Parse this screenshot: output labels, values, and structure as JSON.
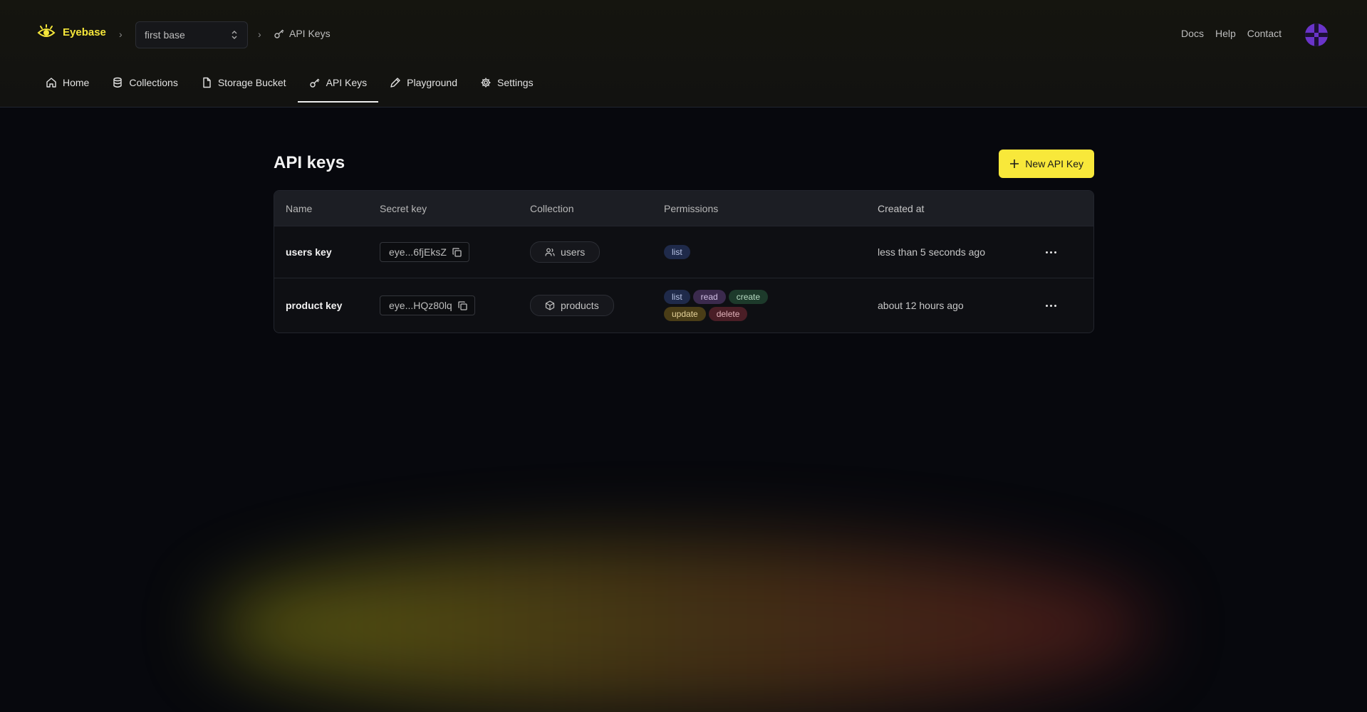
{
  "brand": {
    "name": "Eyebase"
  },
  "breadcrumb": {
    "project": "first base",
    "page": "API Keys"
  },
  "toplinks": [
    "Docs",
    "Help",
    "Contact"
  ],
  "tabs": [
    {
      "label": "Home",
      "icon": "home-icon"
    },
    {
      "label": "Collections",
      "icon": "database-icon"
    },
    {
      "label": "Storage Bucket",
      "icon": "file-icon"
    },
    {
      "label": "API Keys",
      "icon": "key-icon",
      "active": true
    },
    {
      "label": "Playground",
      "icon": "pencil-icon"
    },
    {
      "label": "Settings",
      "icon": "gear-icon"
    }
  ],
  "main": {
    "title": "API keys",
    "new_button": "New API Key",
    "columns": [
      "Name",
      "Secret key",
      "Collection",
      "Permissions",
      "Created at"
    ],
    "rows": [
      {
        "name": "users key",
        "secret": "eye...6fjEksZ",
        "collection": "users",
        "collection_icon": "users-icon",
        "permissions": [
          "list"
        ],
        "created": "less than 5 seconds ago"
      },
      {
        "name": "product key",
        "secret": "eye...HQz80lq",
        "collection": "products",
        "collection_icon": "cube-icon",
        "permissions": [
          "list",
          "read",
          "create",
          "update",
          "delete"
        ],
        "created": "about 12 hours ago"
      }
    ]
  },
  "colors": {
    "accent": "#f8e83a",
    "background": "#07080d",
    "avatar": "#6a34c9"
  }
}
